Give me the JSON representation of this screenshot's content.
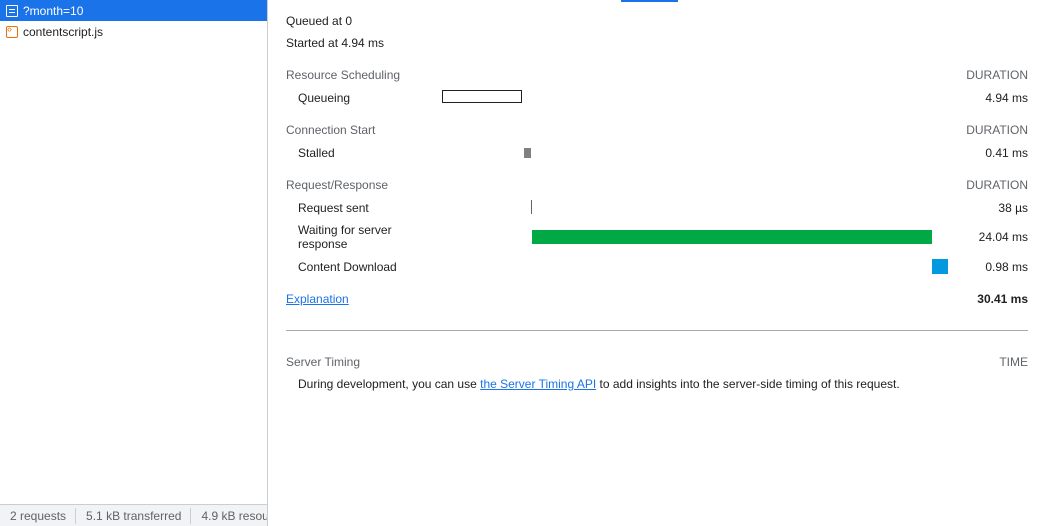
{
  "requests": [
    {
      "name": "?month=10",
      "icon": "document-icon",
      "selected": true
    },
    {
      "name": "contentscript.js",
      "icon": "script-icon",
      "selected": false
    }
  ],
  "status_bar": {
    "requests": "2 requests",
    "transferred": "5.1 kB transferred",
    "resources": "4.9 kB resou"
  },
  "timing": {
    "queued_at": "Queued at 0",
    "started_at": "Started at 4.94 ms",
    "sections": [
      {
        "title": "Resource Scheduling",
        "column": "DURATION",
        "phases": [
          {
            "label": "Queueing",
            "value": "4.94 ms",
            "color": "#ffffff"
          }
        ]
      },
      {
        "title": "Connection Start",
        "column": "DURATION",
        "phases": [
          {
            "label": "Stalled",
            "value": "0.41 ms",
            "color": "#808080"
          }
        ]
      },
      {
        "title": "Request/Response",
        "column": "DURATION",
        "phases": [
          {
            "label": "Request sent",
            "value": "38 µs",
            "color": "#5f6368"
          },
          {
            "label": "Waiting for server response",
            "value": "24.04 ms",
            "color": "#00a846"
          },
          {
            "label": "Content Download",
            "value": "0.98 ms",
            "color": "#0299de"
          }
        ]
      }
    ],
    "explanation": "Explanation",
    "total": "30.41 ms"
  },
  "server_timing": {
    "title": "Server Timing",
    "column": "TIME",
    "text_before": "During development, you can use ",
    "link_text": "the Server Timing API",
    "text_after": " to add insights into the server-side timing of this request."
  },
  "colors": {
    "selection": "#1a73e8",
    "link": "#1a73e8",
    "waiting": "#00a846",
    "download": "#0299de",
    "stalled": "#808080"
  }
}
